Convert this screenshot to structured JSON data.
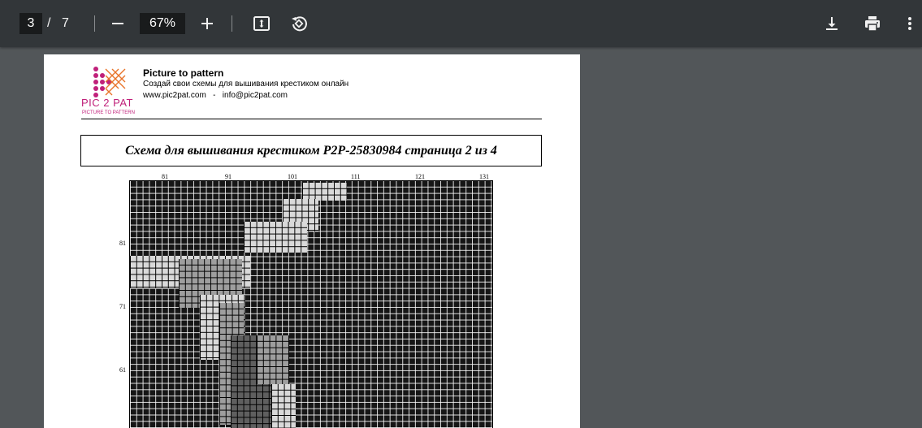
{
  "toolbar": {
    "current_page": "3",
    "page_separator": "/",
    "total_pages": "7",
    "zoom": "67%",
    "icons": [
      "minus-icon",
      "plus-icon",
      "fit-page-icon",
      "rotate-icon",
      "download-icon",
      "print-icon",
      "more-vert-icon"
    ]
  },
  "document": {
    "brand_title": "Picture to pattern",
    "brand_tagline": "Создай свои схемы для вышивания крестиком онлайн",
    "brand_contacts": "www.pic2pat.com   -   info@pic2pat.com",
    "logo_text": "PIC 2 PAT",
    "logo_sub": "PICTURE TO PATTERN",
    "chart_title": "Схема для вышивания крестиком P2P-25830984 страница 2 из 4",
    "col_numbers": [
      "81",
      "91",
      "101",
      "111",
      "121",
      "131"
    ],
    "row_numbers": [
      "81",
      "71",
      "61"
    ]
  },
  "colors": {
    "toolbar_bg": "#323639",
    "viewer_bg": "#525659",
    "logo_pink": "#c0207a",
    "logo_orange": "#e8742a"
  }
}
